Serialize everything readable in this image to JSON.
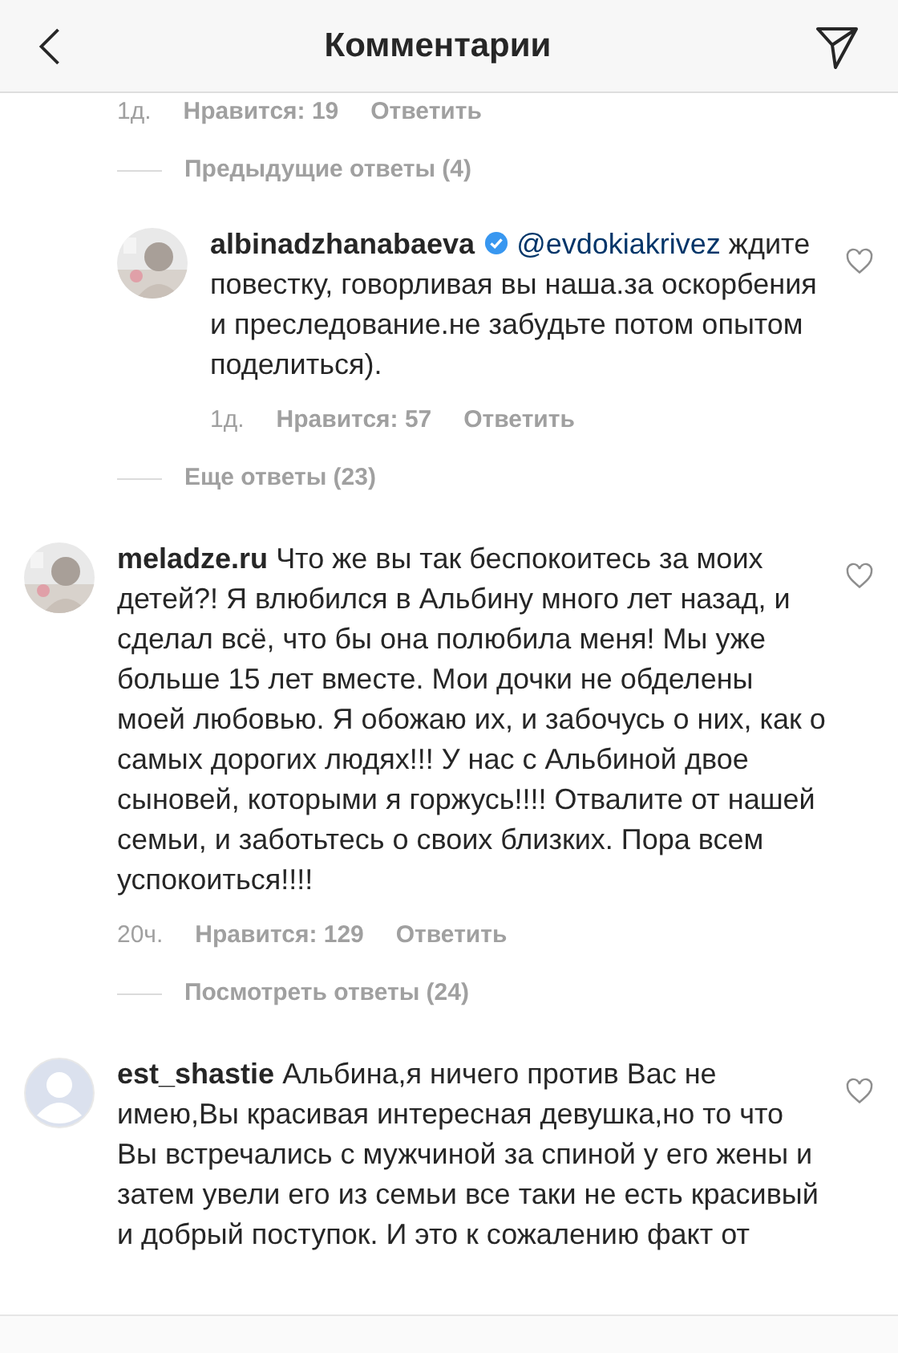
{
  "header": {
    "title": "Комментарии"
  },
  "items": [
    {
      "kind": "meta",
      "time": "1д.",
      "likes": "Нравится: 19",
      "reply": "Ответить"
    },
    {
      "kind": "toggle",
      "label": "Предыдущие ответы (4)",
      "children": [
        {
          "kind": "comment",
          "user": "albinadzhanabaeva",
          "verified": true,
          "mention": "@evdokiakrivez",
          "text": "ждите повестку, говорливая вы наша.за оскорбения и преследование.не забудьте потом опытом поделиться).",
          "liked": false,
          "time": "1д.",
          "likes": "Нравится: 57",
          "reply": "Ответить"
        }
      ]
    },
    {
      "kind": "toggle",
      "label": "Еще ответы (23)"
    },
    {
      "kind": "comment",
      "user": "meladze.ru",
      "verified": false,
      "text": "Что же вы так беспокоитесь за моих детей?! Я влюбился в Альбину много лет назад, и сделал всё, что бы она полюбила меня! Мы уже больше 15 лет вместе. Мои дочки не обделены моей любовью. Я обожаю их, и забочусь о них, как о самых дорогих людях!!! У нас с Альбиной двое сыновей, которыми я горжусь!!!! Отвалите от нашей семьи, и заботьтесь о своих близких. Пора всем успокоиться!!!!",
      "liked": false,
      "time": "20ч.",
      "likes": "Нравится: 129",
      "reply": "Ответить"
    },
    {
      "kind": "toggle",
      "label": "Посмотреть ответы (24)"
    },
    {
      "kind": "comment",
      "avatar": {
        "kind": "default"
      },
      "user": "est_shastie",
      "verified": false,
      "text": "Альбина,я ничего против Вас не имею,Вы красивая интересная девушка,но то что Вы встречались с мужчиной за спиной у его жены и затем увели его из семьи все таки не есть красивый и добрый поступок. И это к сожалению факт от",
      "liked": false
    }
  ]
}
